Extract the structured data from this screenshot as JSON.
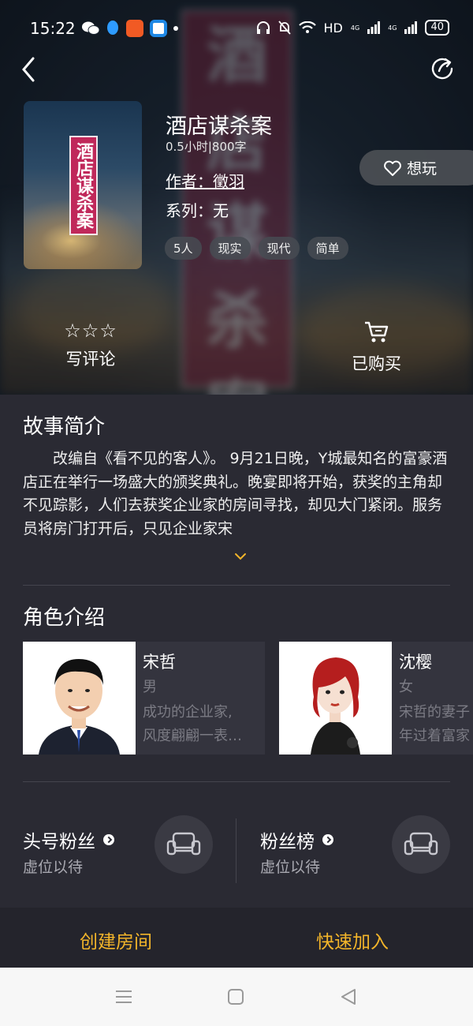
{
  "status_bar": {
    "time": "15:22",
    "hd": "HD",
    "net1": "4G",
    "net2": "4G",
    "battery": "40"
  },
  "header": {
    "back_icon": "chevron-left-icon",
    "share_icon": "share-icon"
  },
  "game": {
    "title": "酒店谋杀案",
    "meta": "0.5小时|800字",
    "author": "作者：徵羽",
    "series": "系列：无",
    "tags": [
      "5人",
      "现实",
      "现代",
      "简单"
    ],
    "cover_text": "酒店谋杀案",
    "want_label": "想玩"
  },
  "actions": {
    "review_stars": "☆☆☆",
    "review_label": "写评论",
    "bought_label": "已购买"
  },
  "synopsis": {
    "heading": "故事简介",
    "text": "改编自《看不见的客人》。 9月21日晚，Y城最知名的富豪酒店正在举行一场盛大的颁奖典礼。晚宴即将开始，获奖的主角却不见踪影，人们去获奖企业家的房间寻找，却见大门紧闭。服务员将房门打开后，只见企业家宋"
  },
  "characters": {
    "heading": "角色介绍",
    "items": [
      {
        "name": "宋哲",
        "gender": "男",
        "desc_line1": "成功的企业家,",
        "desc_line2": "风度翩翩一表…"
      },
      {
        "name": "沈樱",
        "gender": "女",
        "desc_line1": "宋哲的妻子",
        "desc_line2": "年过着富家"
      }
    ]
  },
  "fans": {
    "top_fan_label": "头号粉丝",
    "top_fan_value": "虚位以待",
    "fan_list_label": "粉丝榜",
    "fan_list_value": "虚位以待"
  },
  "bottom": {
    "create_room": "创建房间",
    "quick_join": "快速加入"
  },
  "colors": {
    "accent": "#f3b52a",
    "background": "#2a2a33",
    "card": "#34343e"
  }
}
